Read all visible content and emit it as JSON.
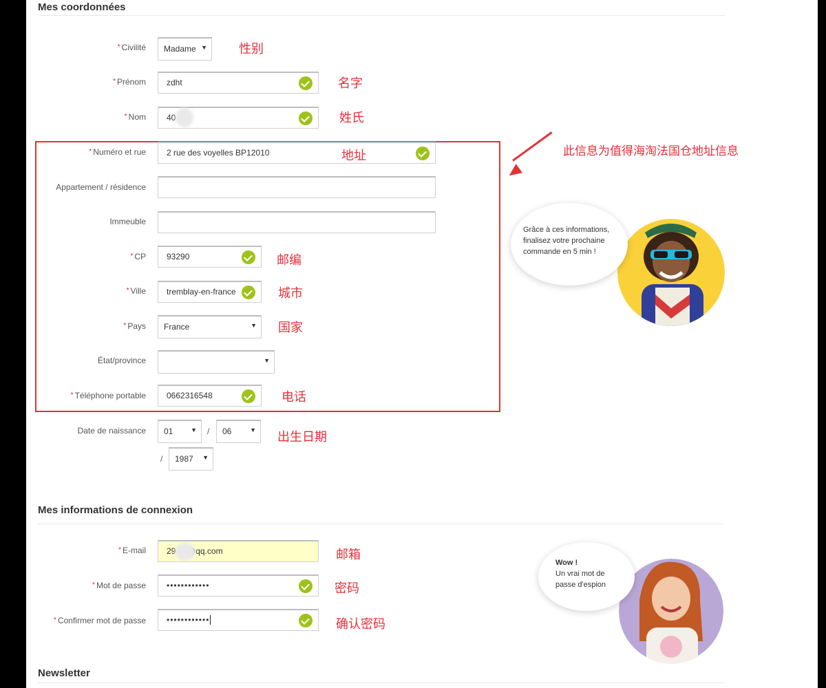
{
  "sections": {
    "coords_title": "Mes coordonnées",
    "connexion_title": "Mes informations de connexion",
    "newsletter_title": "Newsletter"
  },
  "form": {
    "civilite": {
      "label": "Civilité",
      "value": "Madame",
      "note": "性别"
    },
    "prenom": {
      "label": "Prénom",
      "value": "zdht",
      "note": "名字"
    },
    "nom": {
      "label": "Nom",
      "value": "40",
      "note": "姓氏"
    },
    "adresse": {
      "label": "Numéro et rue",
      "value": "2 rue des voyelles BP12010",
      "note": "地址"
    },
    "appartement": {
      "label": "Appartement / résidence",
      "value": ""
    },
    "immeuble": {
      "label": "Immeuble",
      "value": ""
    },
    "cp": {
      "label": "CP",
      "value": "93290",
      "note": "邮编"
    },
    "ville": {
      "label": "Ville",
      "value": "tremblay-en-france",
      "note": "城市"
    },
    "pays": {
      "label": "Pays",
      "value": "France",
      "note": "国家"
    },
    "etat": {
      "label": "État/province",
      "value": ""
    },
    "telephone": {
      "label": "Téléphone portable",
      "value": "0662316548",
      "note": "电话"
    },
    "naissance": {
      "label": "Date de naissance",
      "day": "01",
      "month": "06",
      "year": "1987",
      "note": "出生日期",
      "sep": "/"
    },
    "email": {
      "label": "E-mail",
      "value": "29      73@qq.com",
      "note": "邮箱"
    },
    "password": {
      "label": "Mot de passe",
      "value": "••••••••••••",
      "note": "密码"
    },
    "confirm": {
      "label": "Confirmer mot de passe",
      "value": "••••••••••••",
      "note": "确认密码"
    }
  },
  "annotations": {
    "address_box_note": "此信息为值得海淘法国仓地址信息"
  },
  "bubbles": {
    "first": "Grâce à ces informations, finalisez votre prochaine commande en 5 min !",
    "second_title": "Wow !",
    "second_body": "Un vrai mot de passe d'espion"
  },
  "required_mark": "*",
  "colors": {
    "accent_check": "#9fc21b",
    "annotation_red": "#e23333",
    "email_highlight": "#ffffc8"
  }
}
